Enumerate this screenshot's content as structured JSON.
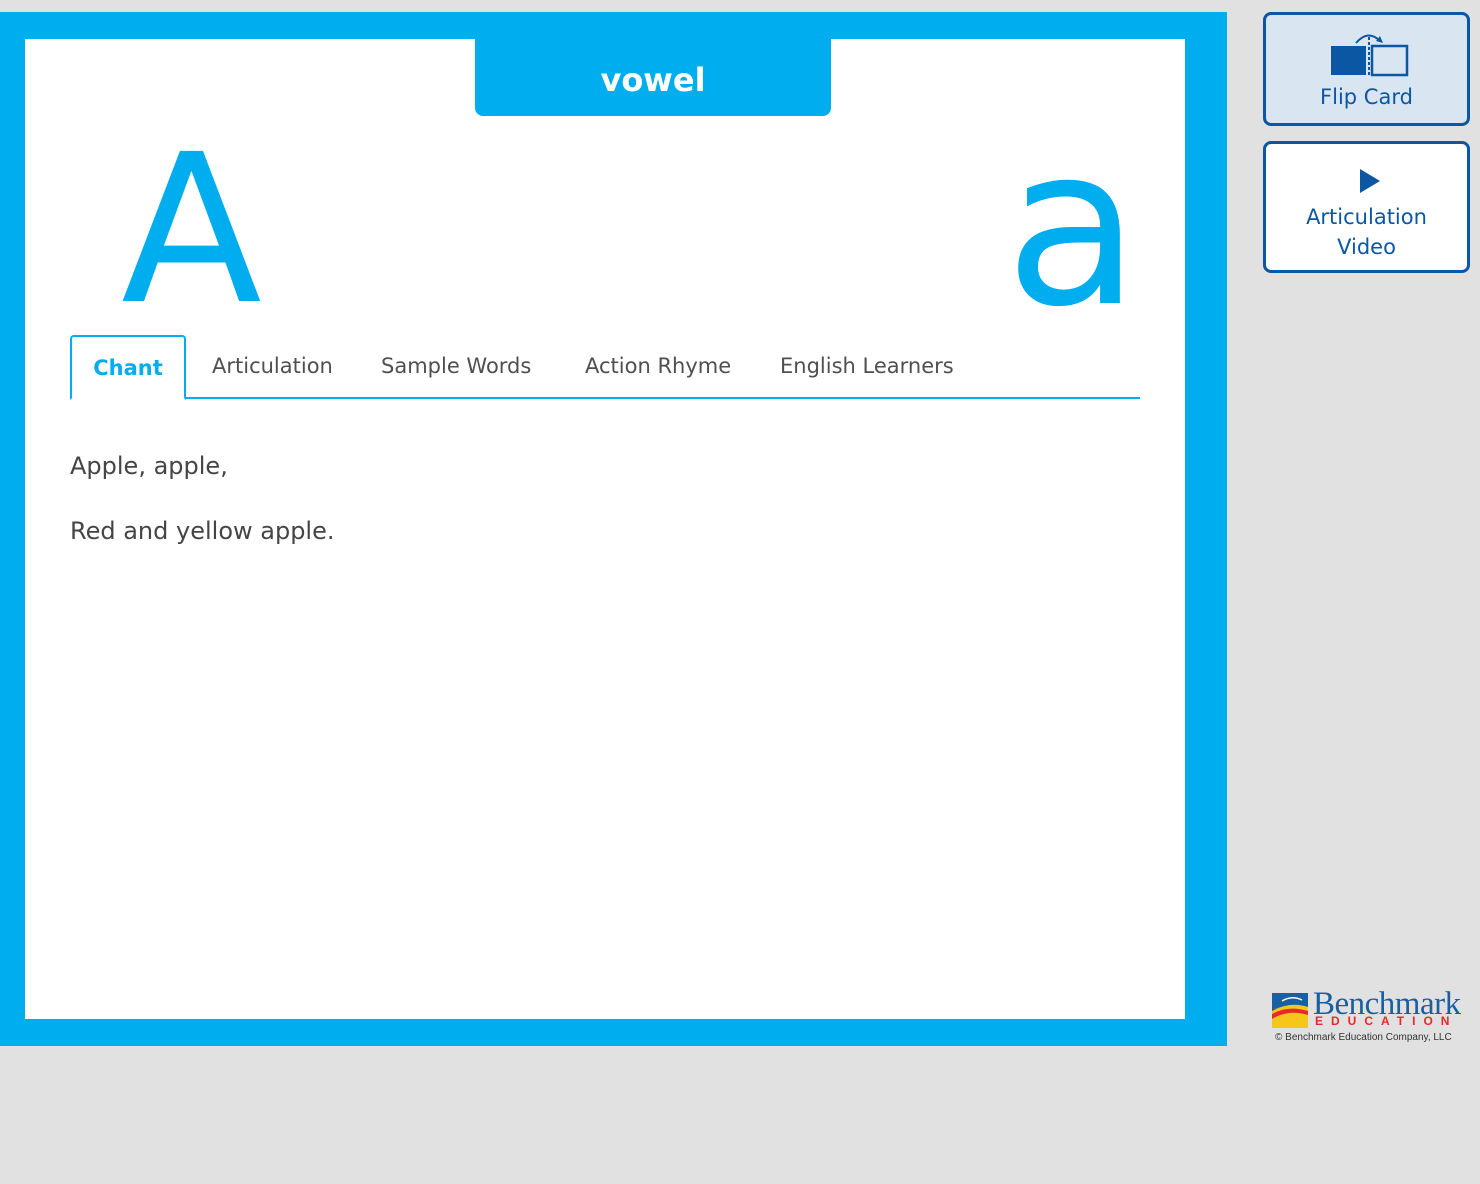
{
  "card": {
    "category": "vowel",
    "uppercase": "A",
    "lowercase": "a"
  },
  "tabs": [
    {
      "label": "Chant",
      "active": true
    },
    {
      "label": "Articulation",
      "active": false
    },
    {
      "label": "Sample Words",
      "active": false
    },
    {
      "label": "Action Rhyme",
      "active": false
    },
    {
      "label": "English Learners",
      "active": false
    }
  ],
  "content": {
    "lines": [
      "Apple, apple,",
      "Red and yellow apple."
    ]
  },
  "sidebar": {
    "flip_card": {
      "label": "Flip Card",
      "icon": "flip-card-icon"
    },
    "articulation_video": {
      "label_line1": "Articulation",
      "label_line2": "Video",
      "icon": "play-icon"
    }
  },
  "logo": {
    "name": "Benchmark",
    "subtitle": "EDUCATION",
    "copyright": "© Benchmark Education Company, LLC"
  },
  "colors": {
    "card_blue": "#00adef",
    "button_blue": "#0b57a4",
    "background": "#e1e1e1",
    "logo_red": "#e8282b"
  }
}
